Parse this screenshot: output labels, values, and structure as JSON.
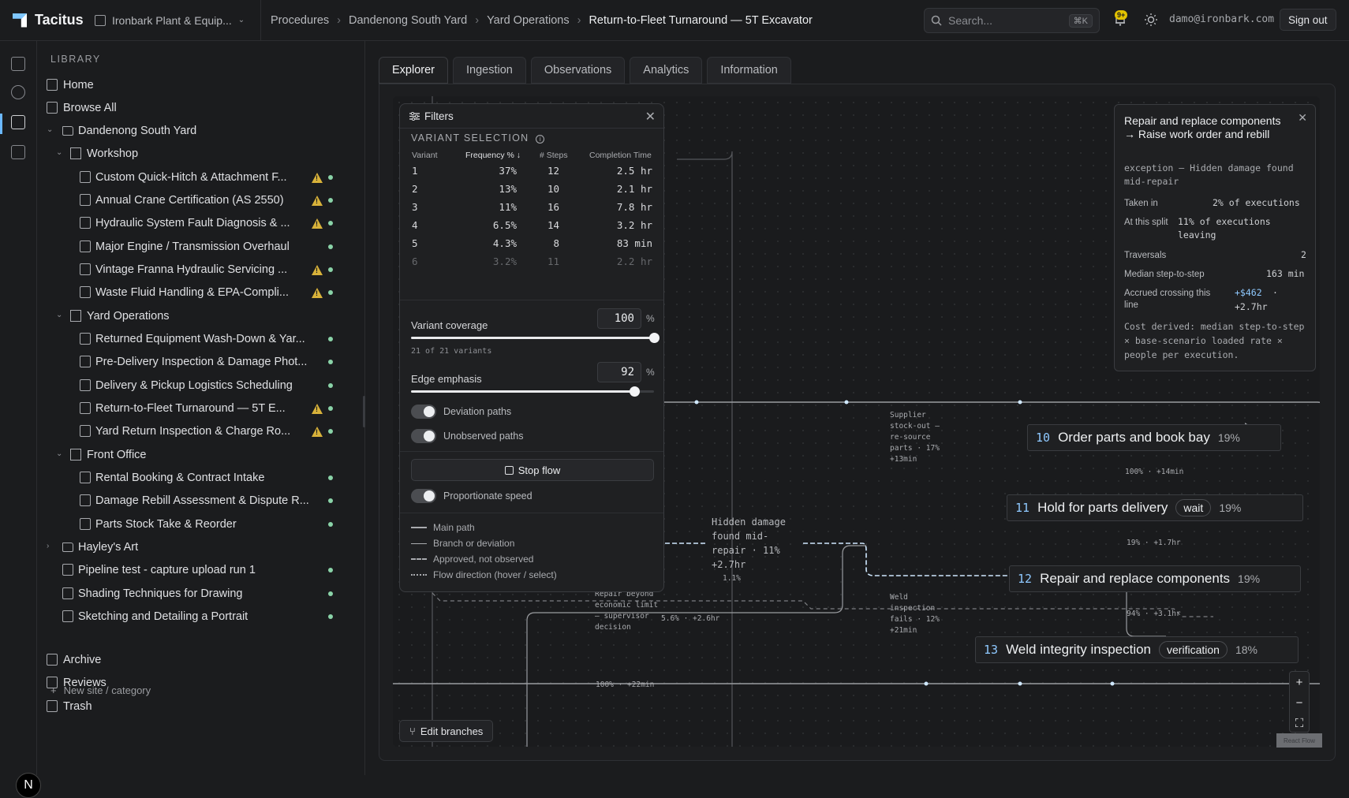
{
  "app": {
    "name": "Tacitus",
    "workspace": "Ironbark Plant & Equip..."
  },
  "breadcrumb": [
    "Procedures",
    "Dandenong South Yard",
    "Yard Operations",
    "Return-to-Fleet Turnaround — 5T Excavator"
  ],
  "search": {
    "placeholder": "Search...",
    "shortcut": "⌘K"
  },
  "notifications": {
    "badge": "9+"
  },
  "user": {
    "email": "damo@ironbark.com",
    "signout_label": "Sign out",
    "avatar_letter": "N"
  },
  "sidebar": {
    "title": "LIBRARY",
    "items": [
      {
        "label": "Home"
      },
      {
        "label": "Browse All"
      },
      {
        "label": "Dandenong South Yard"
      },
      {
        "label": "Workshop"
      },
      {
        "label": "Custom Quick-Hitch & Attachment F..."
      },
      {
        "label": "Annual Crane Certification (AS 2550)"
      },
      {
        "label": "Hydraulic System Fault Diagnosis & ..."
      },
      {
        "label": "Major Engine / Transmission Overhaul"
      },
      {
        "label": "Vintage Franna Hydraulic Servicing ..."
      },
      {
        "label": "Waste Fluid Handling & EPA-Compli..."
      },
      {
        "label": "Yard Operations"
      },
      {
        "label": "Returned Equipment Wash-Down & Yar..."
      },
      {
        "label": "Pre-Delivery Inspection & Damage Phot..."
      },
      {
        "label": "Delivery & Pickup Logistics Scheduling"
      },
      {
        "label": "Return-to-Fleet Turnaround — 5T E..."
      },
      {
        "label": "Yard Return Inspection & Charge Ro..."
      },
      {
        "label": "Front Office"
      },
      {
        "label": "Rental Booking & Contract Intake"
      },
      {
        "label": "Damage Rebill Assessment & Dispute R..."
      },
      {
        "label": "Parts Stock Take & Reorder"
      },
      {
        "label": "Hayley's Art"
      },
      {
        "label": "Pipeline test - capture upload run 1"
      },
      {
        "label": "Shading Techniques for Drawing"
      },
      {
        "label": "Sketching and Detailing a Portrait"
      }
    ],
    "new_site_label": "New site / category",
    "footer": [
      {
        "label": "Archive"
      },
      {
        "label": "Reviews"
      },
      {
        "label": "Trash"
      }
    ]
  },
  "tabs": [
    {
      "label": "Explorer"
    },
    {
      "label": "Ingestion"
    },
    {
      "label": "Observations"
    },
    {
      "label": "Analytics"
    },
    {
      "label": "Information"
    }
  ],
  "filters": {
    "title": "Filters",
    "variant_section": "VARIANT SELECTION",
    "columns": [
      "Variant",
      "Frequency % ↓",
      "# Steps",
      "Completion Time"
    ],
    "variants": [
      [
        "1",
        "37%",
        "12",
        "2.5 hr"
      ],
      [
        "2",
        "13%",
        "10",
        "2.1 hr"
      ],
      [
        "3",
        "11%",
        "16",
        "7.8 hr"
      ],
      [
        "4",
        "6.5%",
        "14",
        "3.2 hr"
      ],
      [
        "5",
        "4.3%",
        "8",
        "83 min"
      ],
      [
        "6",
        "3.2%",
        "11",
        "2.2 hr"
      ]
    ],
    "coverage_label": "Variant coverage",
    "coverage_value": "100",
    "coverage_fraction": 1.0,
    "coverage_note": "21 of 21 variants",
    "emphasis_label": "Edge emphasis",
    "emphasis_value": "92",
    "emphasis_fraction": 0.92,
    "pct_symbol": "%",
    "deviation_label": "Deviation paths",
    "unobserved_label": "Unobserved paths",
    "stopflow_label": "Stop flow",
    "proportionate_label": "Proportionate speed",
    "legend": [
      "Main path",
      "Branch or deviation",
      "Approved, not observed",
      "Flow direction (hover / select)"
    ]
  },
  "detail": {
    "title": "Repair and replace components → Raise work order and rebill",
    "subtitle": "exception — Hidden damage found mid-repair",
    "taken_in_label": "Taken in",
    "taken_in_value": "2% of executions",
    "split_label": "At this split",
    "split_value": "11% of executions leaving",
    "traversals_label": "Traversals",
    "traversals_value": "2",
    "median_label": "Median step-to-step",
    "median_value": "163 min",
    "accrued_label": "Accrued crossing this line",
    "accrued_cost": "+$462",
    "accrued_sep": "·",
    "accrued_time": "+2.7hr",
    "note": "Cost derived: median step-to-step × base-scenario loaded rate × people per execution."
  },
  "flow": {
    "nodes": [
      {
        "num": "10",
        "name": "Order parts and book bay",
        "pill": "",
        "pct": "19%"
      },
      {
        "num": "11",
        "name": "Hold for parts delivery",
        "pill": "wait",
        "pct": "19%"
      },
      {
        "num": "12",
        "name": "Repair and replace components",
        "pill": "",
        "pct": "19%"
      },
      {
        "num": "13",
        "name": "Weld integrity inspection",
        "pill": "verification",
        "pct": "18%"
      }
    ],
    "edge_labels": {
      "supplier": "Supplier stock-out — re-source parts · 17% +13min",
      "e10_11": "100% · +14min",
      "e11_12": "19% · +1.7hr",
      "e12_13": "94% · +3.1hr",
      "hidden": "Hidden damage found mid-repair · 11% +2.7hr",
      "hidden_pct": "1.1%",
      "repair_beyond": "Repair beyond economic limit — supervisor decision",
      "repair_beyond_val": "5.6% · +2.6hr",
      "weld": "Weld inspection fails · 12% +21min",
      "bottom": "100% · +22min"
    }
  },
  "canvas": {
    "edit_branches_label": "Edit branches",
    "zoom_in": "+",
    "zoom_out": "−",
    "fit": "⛶",
    "attribution": "React Flow"
  }
}
